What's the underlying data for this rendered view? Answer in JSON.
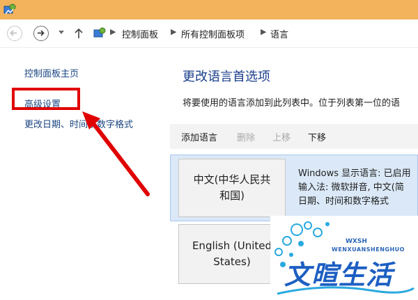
{
  "window": {
    "title_icon": "control-panel-icon",
    "title_bar_color": "#f2b35c"
  },
  "address_bar": {
    "crumbs": [
      "控制面板",
      "所有控制面板项",
      "语言"
    ],
    "separator": "▶"
  },
  "left_pane": {
    "links": [
      "控制面板主页",
      "高级设置",
      "更改日期、时间或数字格式"
    ],
    "highlighted_link_color": "#e00000"
  },
  "main": {
    "title": "更改语言首选项",
    "description": "将要使用的语言添加到此列表中。位于列表第一位的语",
    "toolbar": {
      "add": "添加语言",
      "remove": "删除",
      "move_up": "上移",
      "move_down": "下移"
    },
    "languages": [
      {
        "name_line1": "中文(中华人民共",
        "name_line2": "和国)",
        "info": [
          "Windows 显示语言: 已启用",
          "输入法: 微软拼音, 中文(简",
          "日期、时间和数字格式"
        ]
      },
      {
        "name_line1": "English (United",
        "name_line2": "States)",
        "info": []
      }
    ]
  },
  "watermark": {
    "top_text": "WXSH",
    "sub_text": "WENXUANSHENGHUO",
    "main_text": "文暄生活"
  }
}
